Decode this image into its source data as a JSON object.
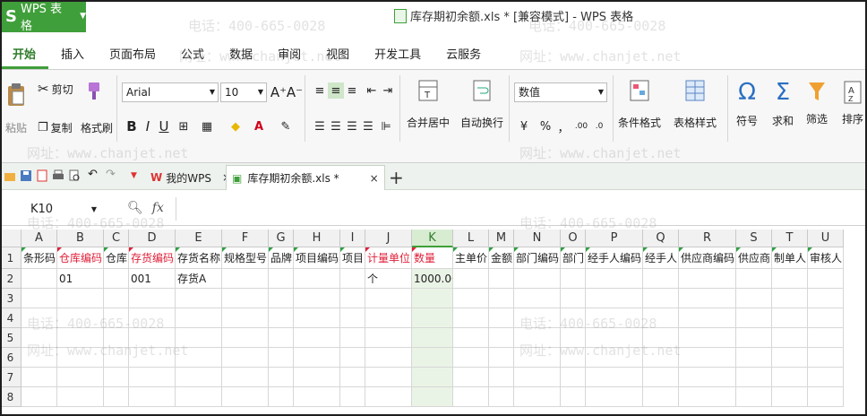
{
  "app": {
    "name": "WPS 表格",
    "window_title": "库存期初余额.xls * [兼容模式] - WPS 表格"
  },
  "ribbon_tabs": [
    "开始",
    "插入",
    "页面布局",
    "公式",
    "数据",
    "审阅",
    "视图",
    "开发工具",
    "云服务"
  ],
  "ribbon": {
    "clipboard": {
      "paste": "粘贴",
      "cut": "剪切",
      "copy": "复制",
      "format_painter": "格式刷"
    },
    "font": {
      "name": "Arial",
      "size": "10",
      "bold": "B",
      "italic": "I",
      "underline": "U",
      "grow": "A⁺",
      "shrink": "A⁻"
    },
    "merge_center": "合并居中",
    "wrap_text": "自动换行",
    "number_format": "数值",
    "percent": "%",
    "comma": "，",
    "conditional_format": "条件格式",
    "table_style": "表格样式",
    "symbol": "符号",
    "sum": "求和",
    "filter": "筛选",
    "sort": "排序",
    "symbol_glyph": "Ω",
    "sum_glyph": "Σ"
  },
  "doc_tabs": [
    {
      "label": "我的WPS",
      "close": "×"
    },
    {
      "label": "库存期初余额.xls *",
      "close": "×"
    }
  ],
  "formula_bar": {
    "name_box": "K10",
    "fx": "fx",
    "value": ""
  },
  "sheet": {
    "columns": [
      "A",
      "B",
      "C",
      "D",
      "E",
      "F",
      "G",
      "H",
      "I",
      "J",
      "K",
      "L",
      "M",
      "N",
      "O",
      "P",
      "Q",
      "R",
      "S",
      "T",
      "U"
    ],
    "selected_column": "K",
    "rows": [
      "1",
      "2",
      "3",
      "4",
      "5",
      "6",
      "7",
      "8"
    ],
    "header_row": [
      "条形码",
      "仓库编码",
      "仓库",
      "存货编码",
      "存货名称",
      "规格型号",
      "品牌",
      "项目编码",
      "项目",
      "计量单位",
      "数量",
      "主单价",
      "金额",
      "部门编码",
      "部门",
      "经手人编码",
      "经手人",
      "供应商编码",
      "供应商",
      "制单人",
      "审核人"
    ],
    "required_columns": [
      "B",
      "D",
      "J",
      "K"
    ],
    "row2": {
      "B": "01",
      "D": "001",
      "E": "存货A",
      "J": "个",
      "K": "1000.00"
    }
  },
  "watermark": {
    "phone": "电话：400-665-0028",
    "site": "网址：www.chanjet.net"
  }
}
